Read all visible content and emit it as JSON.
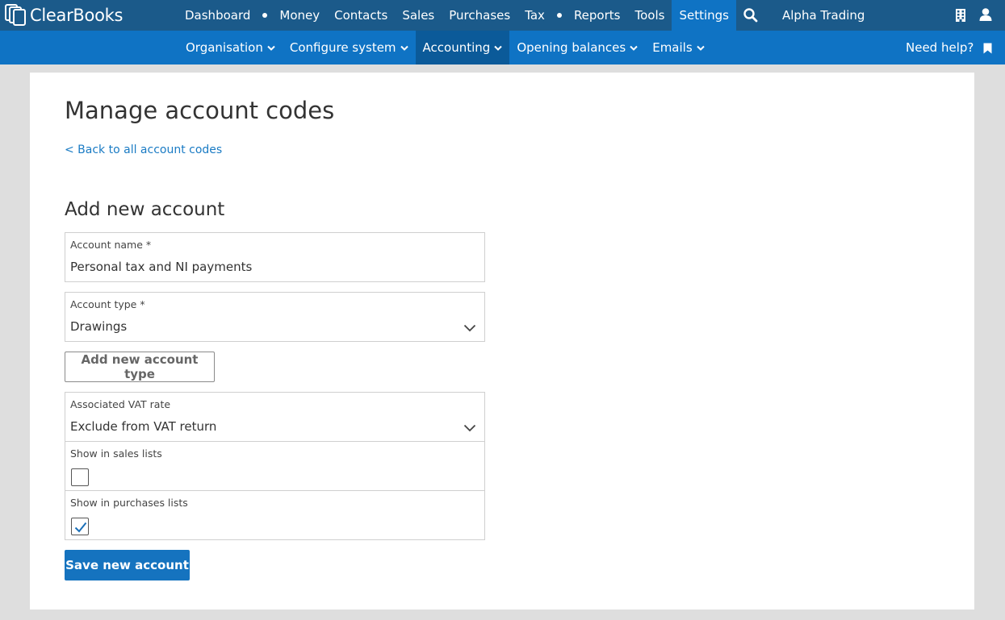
{
  "brand": {
    "name": "ClearBooks"
  },
  "topnav": {
    "items": [
      {
        "label": "Dashboard"
      },
      {
        "label": "Money"
      },
      {
        "label": "Contacts"
      },
      {
        "label": "Sales"
      },
      {
        "label": "Purchases"
      },
      {
        "label": "Tax"
      },
      {
        "label": "Reports"
      },
      {
        "label": "Tools"
      },
      {
        "label": "Settings",
        "active": true
      }
    ],
    "organisation": "Alpha Trading"
  },
  "subnav": {
    "items": [
      {
        "label": "Organisation"
      },
      {
        "label": "Configure system"
      },
      {
        "label": "Accounting",
        "active": true
      },
      {
        "label": "Opening balances"
      },
      {
        "label": "Emails"
      }
    ],
    "help": "Need help?"
  },
  "page": {
    "title": "Manage account codes",
    "back_link": "< Back to all account codes",
    "section_title": "Add new account"
  },
  "form": {
    "account_name": {
      "label": "Account name *",
      "value": "Personal tax and NI payments"
    },
    "account_type": {
      "label": "Account type *",
      "value": "Drawings"
    },
    "add_type_button": "Add new account type",
    "vat_rate": {
      "label": "Associated VAT rate",
      "value": "Exclude from VAT return"
    },
    "show_in_sales": {
      "label": "Show in sales lists",
      "checked": false
    },
    "show_in_purchases": {
      "label": "Show in purchases lists",
      "checked": true
    },
    "save_button": "Save new account"
  },
  "colors": {
    "topbar": "#1b5a8a",
    "subbar": "#0f73c4",
    "accent": "#1573bf",
    "link": "#1a7bc4"
  }
}
